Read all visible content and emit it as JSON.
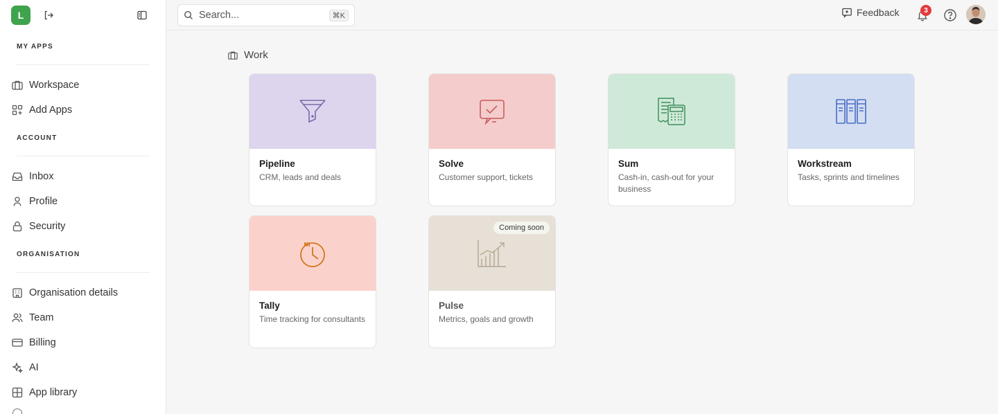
{
  "sidebar": {
    "logo_letter": "L",
    "sections": {
      "my_apps": "MY APPS",
      "account": "ACCOUNT",
      "organisation": "ORGANISATION"
    },
    "items": {
      "workspace": "Workspace",
      "add_apps": "Add Apps",
      "inbox": "Inbox",
      "profile": "Profile",
      "security": "Security",
      "org_details": "Organisation details",
      "team": "Team",
      "billing": "Billing",
      "ai": "AI",
      "app_library": "App library"
    }
  },
  "topbar": {
    "search_placeholder": "Search...",
    "search_shortcut": "⌘K",
    "feedback_label": "Feedback",
    "notification_count": "3"
  },
  "main": {
    "section_title": "Work",
    "apps": [
      {
        "name": "Pipeline",
        "description": "CRM, leads and deals",
        "color": "#ddd4ee",
        "icon": "funnel-icon"
      },
      {
        "name": "Solve",
        "description": "Customer support, tickets",
        "color": "#f5cccc",
        "icon": "chat-check-icon"
      },
      {
        "name": "Sum",
        "description": "Cash-in, cash-out for your business",
        "color": "#cfe9d9",
        "icon": "calculator-icon"
      },
      {
        "name": "Workstream",
        "description": "Tasks, sprints and timelines",
        "color": "#d3def2",
        "icon": "columns-icon"
      },
      {
        "name": "Tally",
        "description": "Time tracking for consultants",
        "color": "#fbd2cb",
        "icon": "clock-icon"
      },
      {
        "name": "Pulse",
        "description": "Metrics, goals and growth",
        "color": "#e6e0d6",
        "icon": "chart-icon",
        "badge": "Coming soon"
      }
    ]
  }
}
